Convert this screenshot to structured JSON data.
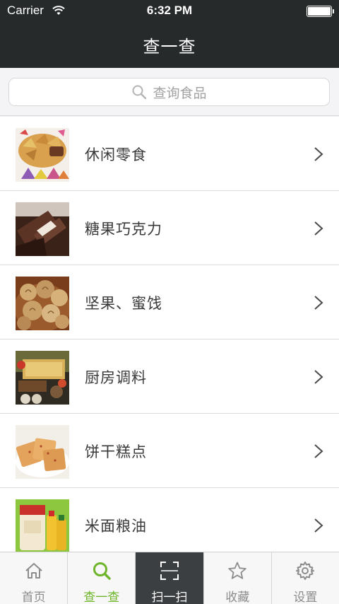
{
  "status_bar": {
    "carrier": "Carrier",
    "time": "6:32 PM"
  },
  "nav": {
    "title": "查一查"
  },
  "search": {
    "placeholder": "查询食品"
  },
  "categories": [
    {
      "label": "休闲零食"
    },
    {
      "label": "糖果巧克力"
    },
    {
      "label": "坚果、蜜饯"
    },
    {
      "label": "厨房调料"
    },
    {
      "label": "饼干糕点"
    },
    {
      "label": "米面粮油"
    }
  ],
  "tabs": [
    {
      "label": "首页",
      "icon": "home-icon"
    },
    {
      "label": "查一查",
      "icon": "search-icon"
    },
    {
      "label": "扫一扫",
      "icon": "scan-icon"
    },
    {
      "label": "收藏",
      "icon": "star-icon"
    },
    {
      "label": "设置",
      "icon": "settings-icon"
    }
  ],
  "colors": {
    "nav_bg": "#262a2b",
    "active_tab": "#6fb52c",
    "scan_tab_bg": "#3c3f41"
  }
}
